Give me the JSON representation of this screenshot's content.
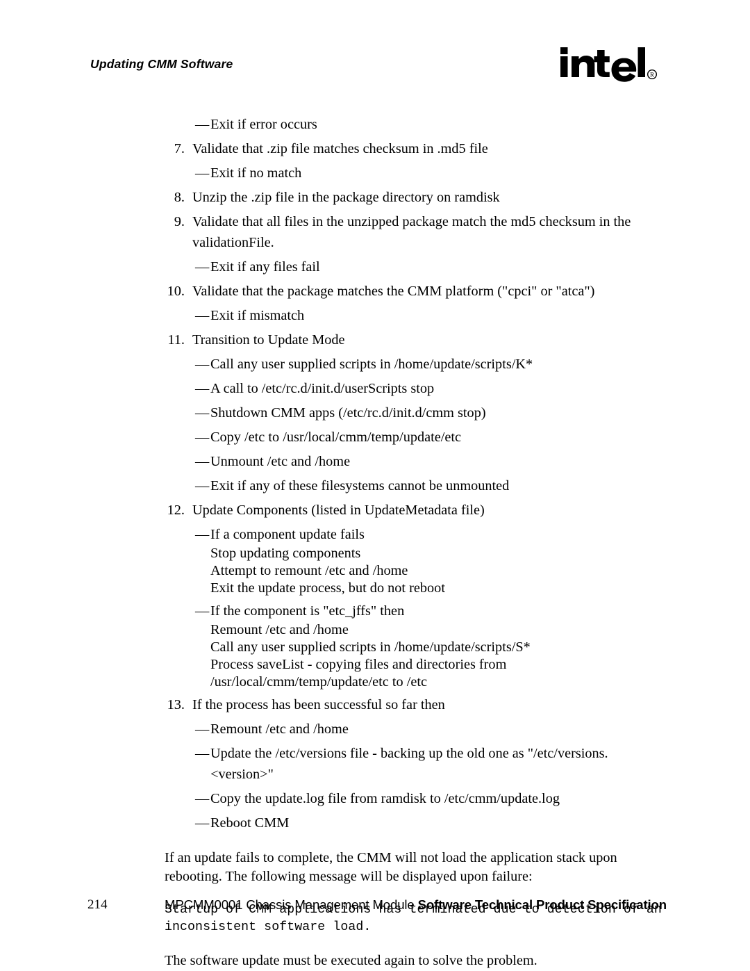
{
  "header": {
    "title": "Updating CMM Software",
    "logo": {
      "name": "intel-logo",
      "wordmark": "intel",
      "trademark": "®"
    }
  },
  "content": {
    "blocks": [
      {
        "kind": "sub",
        "text": "Exit if error occurs"
      },
      {
        "kind": "step",
        "num": "7.",
        "text": "Validate that .zip file matches checksum in .md5 file"
      },
      {
        "kind": "sub",
        "text": "Exit if no match"
      },
      {
        "kind": "step",
        "num": "8.",
        "text": "Unzip the .zip file in the package directory on ramdisk"
      },
      {
        "kind": "step",
        "num": "9.",
        "text": "Validate that all files in the unzipped package match the md5 checksum in the validationFile."
      },
      {
        "kind": "sub",
        "text": "Exit if any files fail"
      },
      {
        "kind": "step",
        "num": "10.",
        "text": "Validate that the package matches the CMM platform (\"cpci\" or \"atca\")"
      },
      {
        "kind": "sub",
        "text": "Exit if mismatch"
      },
      {
        "kind": "step",
        "num": "11.",
        "text": "Transition to Update Mode"
      },
      {
        "kind": "sub",
        "text": "Call any user supplied scripts in /home/update/scripts/K*"
      },
      {
        "kind": "sub",
        "text": "A call to /etc/rc.d/init.d/userScripts stop"
      },
      {
        "kind": "sub",
        "text": "Shutdown CMM apps (/etc/rc.d/init.d/cmm stop)"
      },
      {
        "kind": "sub",
        "text": "Copy /etc to /usr/local/cmm/temp/update/etc"
      },
      {
        "kind": "sub",
        "text": "Unmount /etc and /home"
      },
      {
        "kind": "sub",
        "text": "Exit if any of these filesystems cannot be unmounted"
      },
      {
        "kind": "step",
        "num": "12.",
        "text": "Update Components (listed in UpdateMetadata file)"
      },
      {
        "kind": "sub",
        "text": "If a component update fails"
      },
      {
        "kind": "plain",
        "text": "Stop updating components"
      },
      {
        "kind": "plain",
        "text": "Attempt to remount /etc and /home"
      },
      {
        "kind": "plain",
        "text": "Exit the update process, but do not reboot"
      },
      {
        "kind": "sub",
        "text": "If the component is \"etc_jffs\" then"
      },
      {
        "kind": "plain",
        "text": "Remount /etc and /home"
      },
      {
        "kind": "plain",
        "text": "Call any user supplied scripts in /home/update/scripts/S*"
      },
      {
        "kind": "plain",
        "text": "Process saveList - copying files and directories from /usr/local/cmm/temp/update/etc to /etc"
      },
      {
        "kind": "step",
        "num": "13.",
        "text": "If the process has been successful so far then"
      },
      {
        "kind": "sub",
        "text": "Remount /etc and /home"
      },
      {
        "kind": "sub",
        "text": "Update the /etc/versions file - backing up the old one as \"/etc/versions.<version>\""
      },
      {
        "kind": "sub",
        "text": "Copy the update.log file from ramdisk to /etc/cmm/update.log"
      },
      {
        "kind": "sub",
        "text": "Reboot CMM"
      },
      {
        "kind": "para",
        "text": "If an update fails to complete, the CMM will not load the application stack upon rebooting. The following message will be displayed upon failure:"
      },
      {
        "kind": "code",
        "text": "Startup of CMM applications has terminated due to detection of an\ninconsistent software load."
      },
      {
        "kind": "para",
        "text": "The software update must be executed again to solve the problem."
      }
    ]
  },
  "footer": {
    "page_number": "214",
    "doc_name": "MPCMM0001 Chassis Management Module ",
    "doc_title": "Software Technical Product Specification"
  }
}
